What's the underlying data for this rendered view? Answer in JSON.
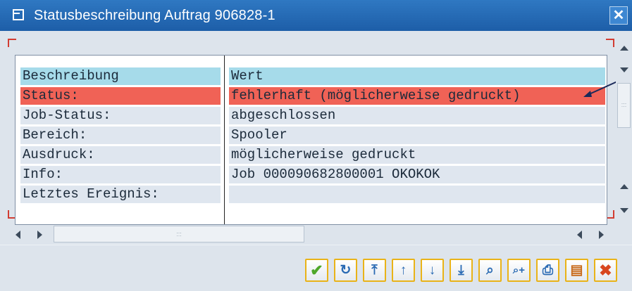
{
  "dialog": {
    "title": "Statusbeschreibung Auftrag 906828-1",
    "close_symbol": "✕"
  },
  "table": {
    "columns": [
      "Beschreibung",
      "Wert"
    ],
    "rows": [
      {
        "label": "Status:",
        "value": "fehlerhaft (möglicherweise gedruckt)",
        "highlight": "error"
      },
      {
        "label": "Job-Status:",
        "value": "abgeschlossen"
      },
      {
        "label": "Bereich:",
        "value": "Spooler"
      },
      {
        "label": "Ausdruck:",
        "value": "möglicherweise gedruckt"
      },
      {
        "label": "Info:",
        "value": "Job 000090682800001 OKOKOK"
      },
      {
        "label": "Letztes Ereignis:",
        "value": ""
      }
    ]
  },
  "scrollbar_grip": ":::",
  "toolbar": {
    "buttons": [
      {
        "name": "confirm-button",
        "icon": "check-icon",
        "glyph": "✔"
      },
      {
        "name": "refresh-button",
        "icon": "refresh-icon",
        "glyph": "↻"
      },
      {
        "name": "first-page-button",
        "icon": "first-page-icon",
        "glyph": "⤒"
      },
      {
        "name": "previous-page-button",
        "icon": "previous-page-icon",
        "glyph": "↑"
      },
      {
        "name": "next-page-button",
        "icon": "next-page-icon",
        "glyph": "↓"
      },
      {
        "name": "last-page-button",
        "icon": "last-page-icon",
        "glyph": "⤓"
      },
      {
        "name": "find-button",
        "icon": "binoculars-icon",
        "glyph": "⌕"
      },
      {
        "name": "find-next-button",
        "icon": "binoculars-plus-icon",
        "glyph": "⌕+"
      },
      {
        "name": "print-button",
        "icon": "printer-icon",
        "glyph": "⎙"
      },
      {
        "name": "local-file-button",
        "icon": "local-file-icon",
        "glyph": "▤"
      },
      {
        "name": "cancel-button",
        "icon": "cancel-icon",
        "glyph": "✖"
      }
    ]
  },
  "colors": {
    "title_bar": "#1d5ea8",
    "header_row": "#a6dbea",
    "error_row": "#f06256",
    "normal_row": "#dfe6ef",
    "button_border": "#e9b318"
  }
}
